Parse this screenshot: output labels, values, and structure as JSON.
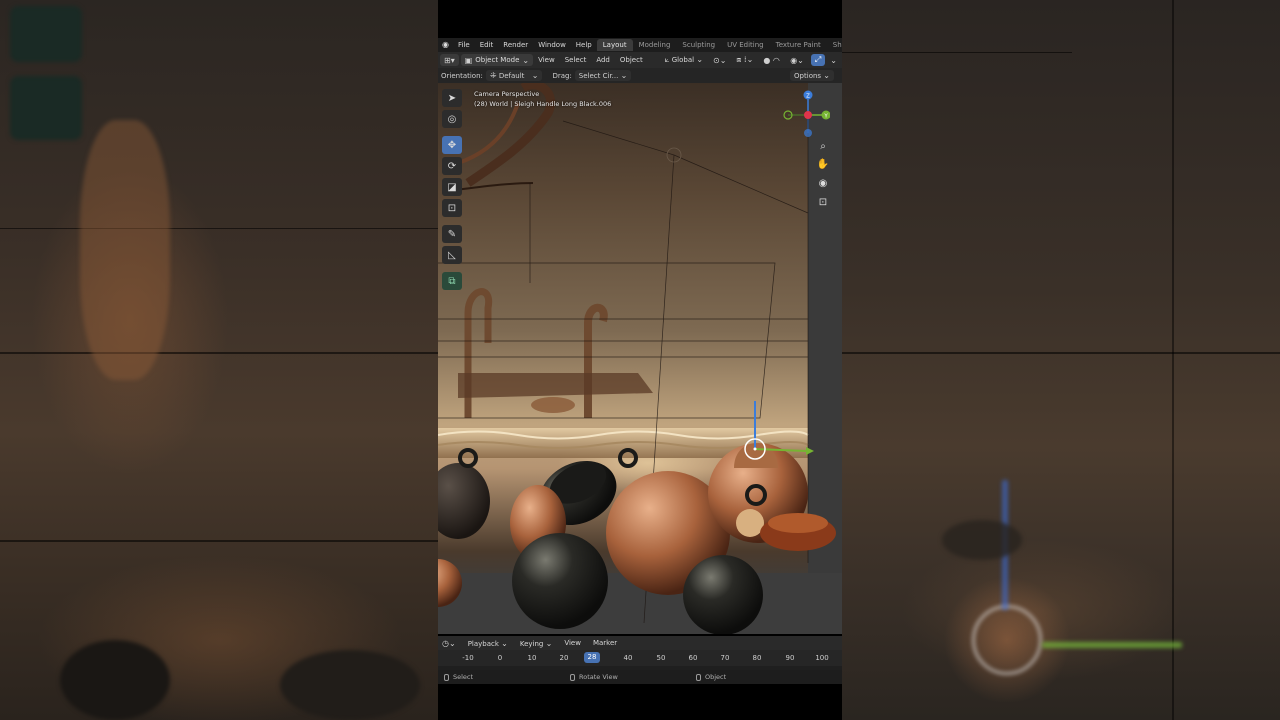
{
  "topbar": {
    "menus": [
      "File",
      "Edit",
      "Render",
      "Window",
      "Help"
    ],
    "workspaces": [
      "Layout",
      "Modeling",
      "Sculpting",
      "UV Editing",
      "Texture Paint",
      "Shading"
    ],
    "active_workspace": "Layout"
  },
  "header": {
    "mode": "Object Mode",
    "menus": [
      "View",
      "Select",
      "Add",
      "Object"
    ],
    "transform_orientation": "Global"
  },
  "tool_settings": {
    "orientation_label": "Orientation:",
    "orientation_value": "Default",
    "drag_label": "Drag:",
    "drag_value": "Select Cir...",
    "options_label": "Options"
  },
  "viewport": {
    "view_name": "Camera Perspective",
    "object_info": "(28) World | Sleigh Handle Long Black.006",
    "gizmo_axes": {
      "z": "Z",
      "y": "Y"
    },
    "colors": {
      "x_axis": "#e0344b",
      "y_axis": "#76b432",
      "z_axis": "#3b7ddb",
      "active_tool": "#4772b3"
    }
  },
  "toolbar_tools": [
    {
      "name": "select-box-tool",
      "icon": "cursor-icon"
    },
    {
      "name": "cursor-tool",
      "icon": "3d-cursor-icon"
    },
    {
      "name": "move-tool",
      "icon": "move-icon"
    },
    {
      "name": "rotate-tool",
      "icon": "rotate-icon"
    },
    {
      "name": "scale-tool",
      "icon": "scale-icon"
    },
    {
      "name": "transform-tool",
      "icon": "transform-icon"
    },
    {
      "name": "annotate-tool",
      "icon": "annotate-icon"
    },
    {
      "name": "measure-tool",
      "icon": "measure-icon"
    },
    {
      "name": "add-cube-tool",
      "icon": "add-cube-icon"
    }
  ],
  "timeline": {
    "menus": [
      "Playback",
      "Keying",
      "View",
      "Marker"
    ],
    "ticks": [
      "-10",
      "0",
      "10",
      "20",
      "40",
      "50",
      "60",
      "70",
      "80",
      "90",
      "100"
    ],
    "current_frame": "28"
  },
  "status_bar": {
    "left": "Select",
    "middle": "Rotate View",
    "right": "Object"
  }
}
